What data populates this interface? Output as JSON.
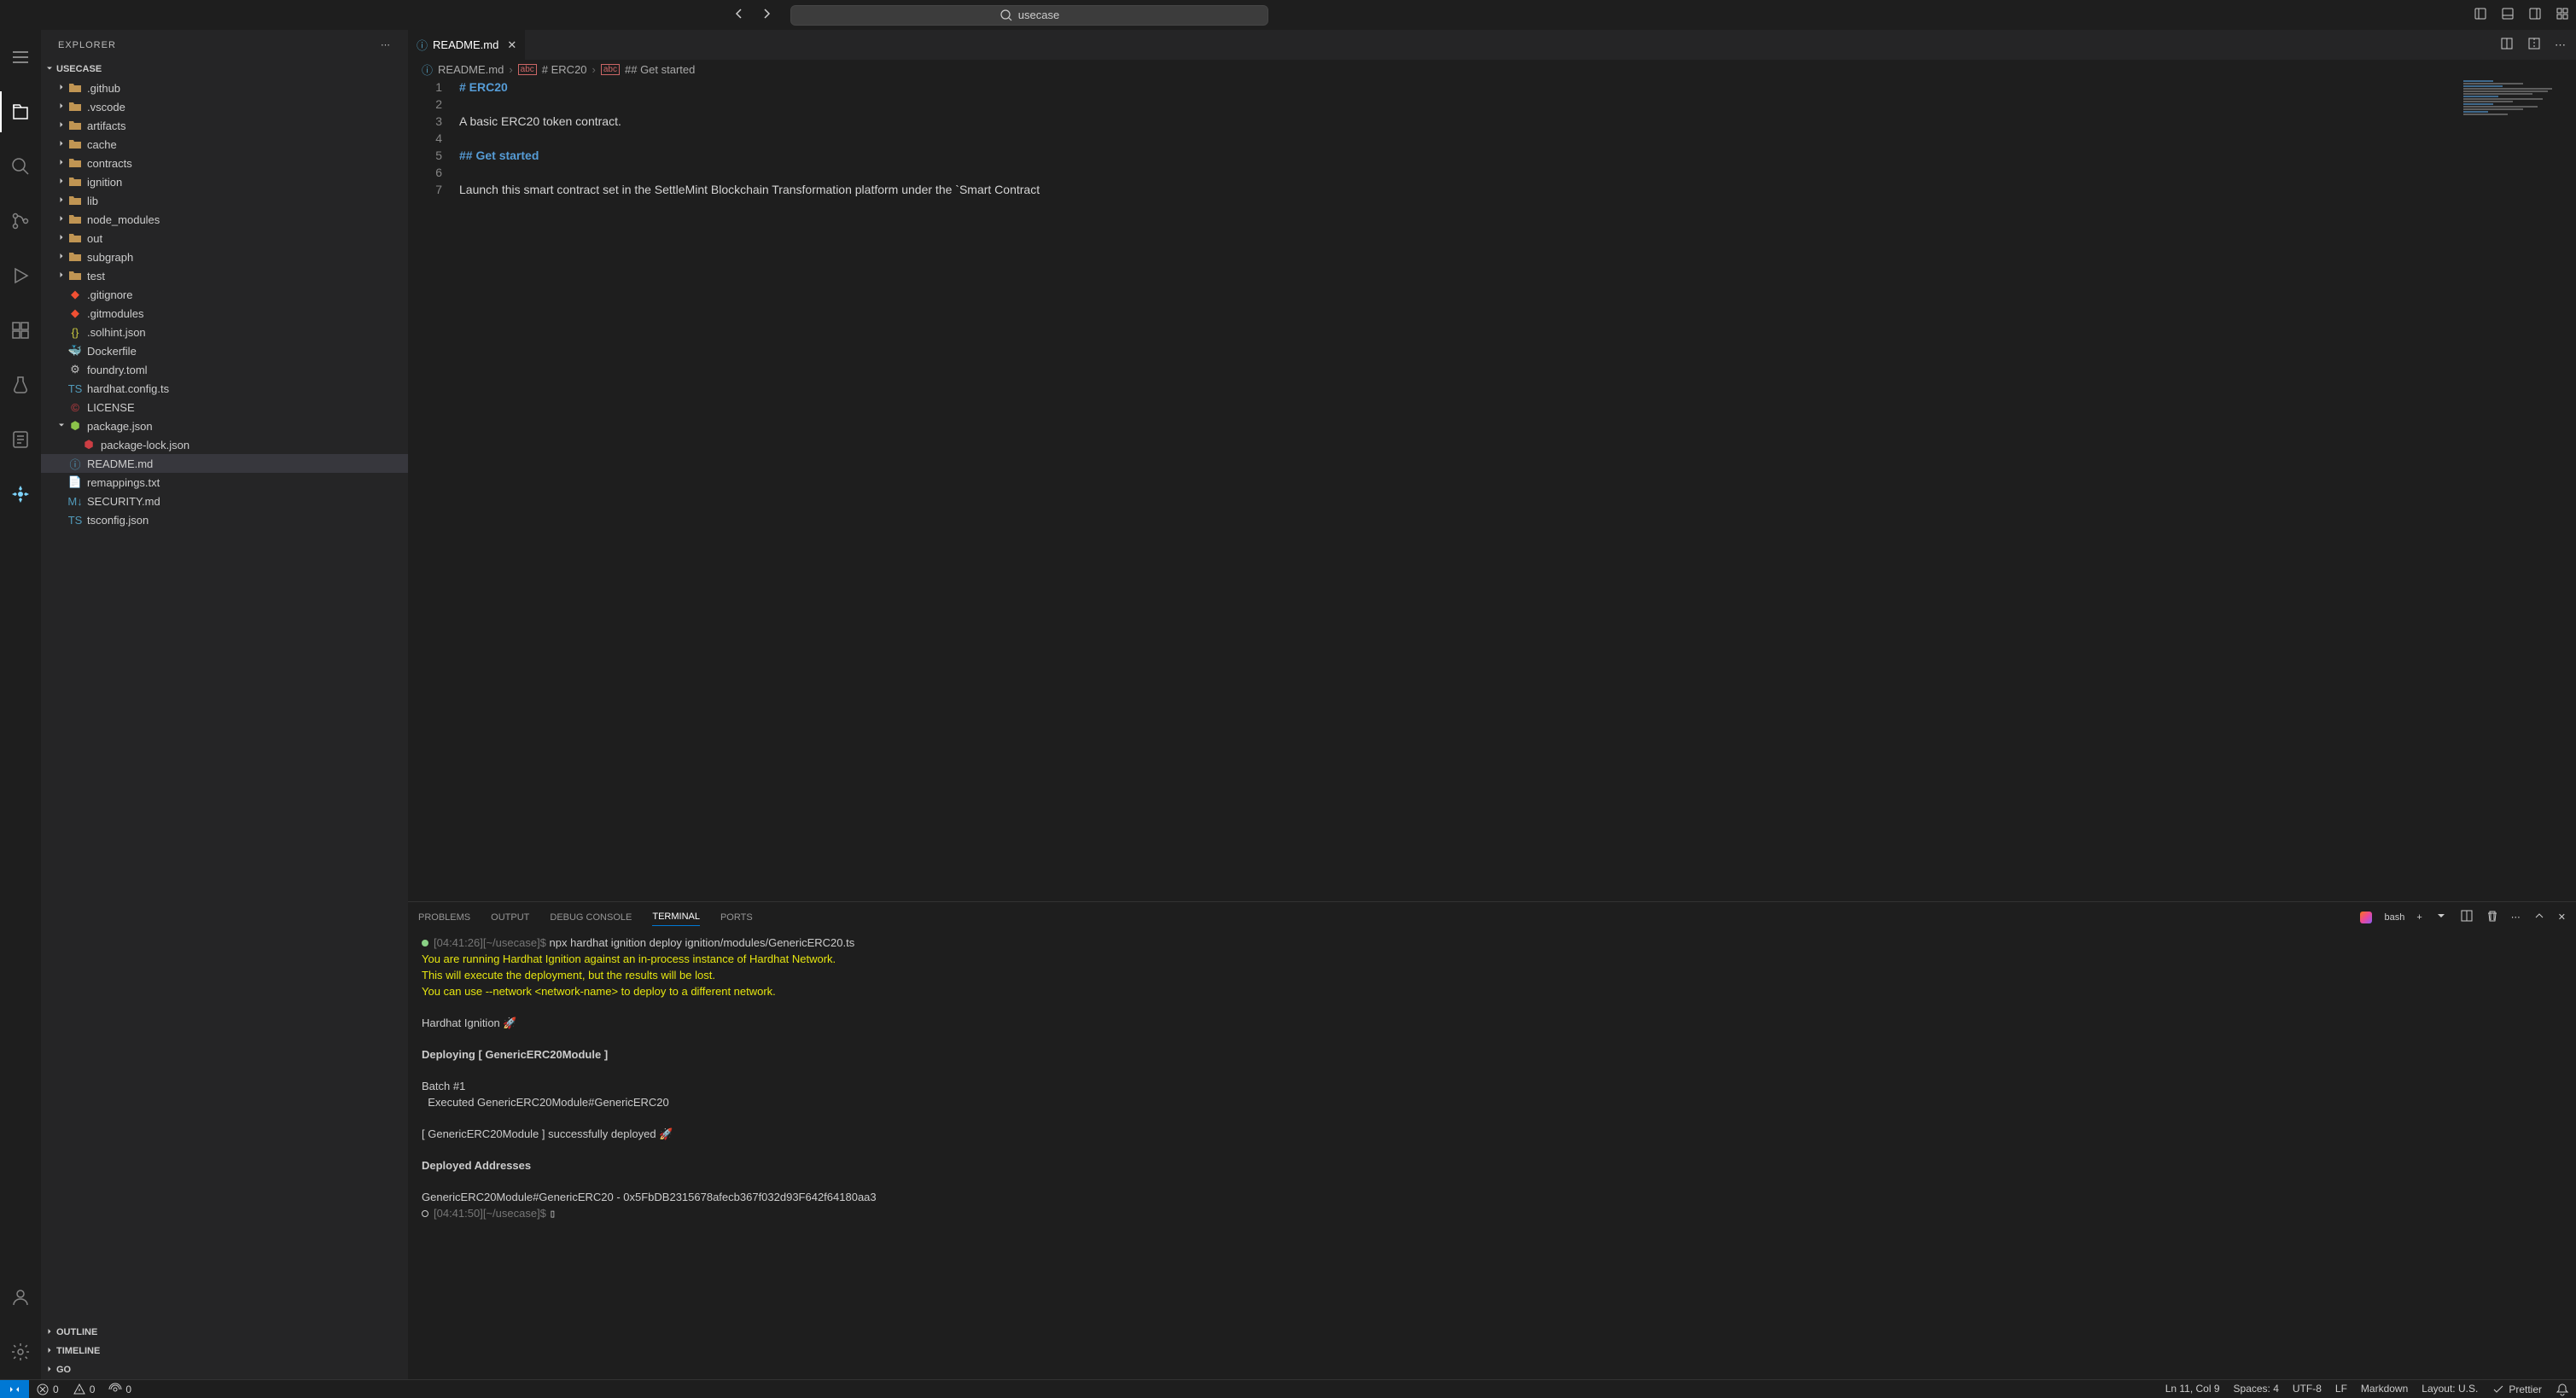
{
  "titlebar": {
    "search_text": "usecase"
  },
  "sidebar": {
    "title": "EXPLORER",
    "workspace": "USECASE",
    "folders": [
      ".github",
      ".vscode",
      "artifacts",
      "cache",
      "contracts",
      "ignition",
      "lib",
      "node_modules",
      "out",
      "subgraph",
      "test"
    ],
    "files": [
      {
        "name": ".gitignore",
        "color": "#cccccc"
      },
      {
        "name": ".gitmodules",
        "color": "#cccccc"
      },
      {
        "name": ".solhint.json",
        "color": "#cccccc"
      },
      {
        "name": "Dockerfile",
        "color": "#cccccc"
      },
      {
        "name": "foundry.toml",
        "color": "#cccccc"
      },
      {
        "name": "hardhat.config.ts",
        "color": "#cccccc"
      },
      {
        "name": "LICENSE",
        "color": "#cccccc"
      },
      {
        "name": "package.json",
        "color": "#cccccc"
      },
      {
        "name": "package-lock.json",
        "color": "#cccccc"
      },
      {
        "name": "README.md",
        "color": "#cccccc"
      },
      {
        "name": "remappings.txt",
        "color": "#cccccc"
      },
      {
        "name": "SECURITY.md",
        "color": "#cccccc"
      },
      {
        "name": "tsconfig.json",
        "color": "#cccccc"
      }
    ],
    "sections": [
      "OUTLINE",
      "TIMELINE",
      "GO"
    ]
  },
  "tab": {
    "title": "README.md"
  },
  "breadcrumb": {
    "file": "README.md",
    "h1": "# ERC20",
    "h2": "## Get started"
  },
  "editor": {
    "lines": [
      "# ERC20",
      "",
      "A basic ERC20 token contract.",
      "",
      "## Get started",
      "",
      "Launch this smart contract set in the SettleMint Blockchain Transformation platform under the `Smart Contract"
    ]
  },
  "panel": {
    "tabs": [
      "PROBLEMS",
      "OUTPUT",
      "DEBUG CONSOLE",
      "TERMINAL",
      "PORTS"
    ],
    "active_tab": "TERMINAL",
    "shell": "bash"
  },
  "terminal": {
    "line1_prompt": "[04:41:26][~/usecase]$ ",
    "line1_cmd": "npx hardhat ignition deploy ignition/modules/GenericERC20.ts",
    "line2": "You are running Hardhat Ignition against an in-process instance of Hardhat Network.",
    "line3": "This will execute the deployment, but the results will be lost.",
    "line4": "You can use --network <network-name> to deploy to a different network.",
    "line5": "Hardhat Ignition 🚀",
    "line6": "Deploying [ GenericERC20Module ]",
    "line7": "Batch #1",
    "line8": "  Executed GenericERC20Module#GenericERC20",
    "line9": "[ GenericERC20Module ] successfully deployed 🚀",
    "line10": "Deployed Addresses",
    "line11": "GenericERC20Module#GenericERC20 - 0x5FbDB2315678afecb367f032d93F642f64180aa3",
    "line12_prompt": "[04:41:50][~/usecase]$ "
  },
  "statusbar": {
    "errors": "0",
    "warnings": "0",
    "ports": "0",
    "position": "Ln 11, Col 9",
    "spaces": "Spaces: 4",
    "encoding": "UTF-8",
    "eol": "LF",
    "language": "Markdown",
    "layout": "Layout: U.S.",
    "prettier": "Prettier"
  }
}
